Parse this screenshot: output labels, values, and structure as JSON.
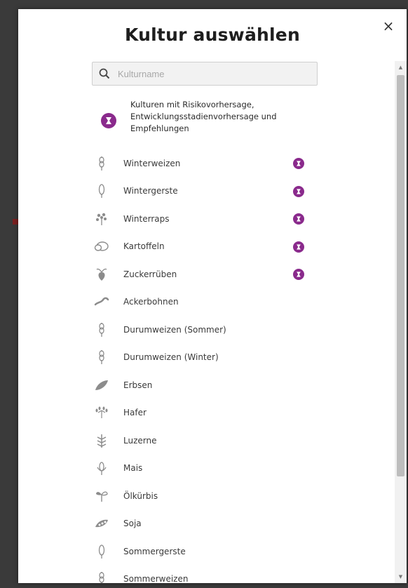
{
  "dialog": {
    "title": "Kultur auswählen",
    "close_label": "×"
  },
  "search": {
    "placeholder": "Kulturname",
    "value": ""
  },
  "legend": {
    "text": "Kulturen mit Risikovorhersage, Entwicklungsstadienvorhersage und Empfehlungen",
    "badge_color": "#8a2a8c"
  },
  "crops": [
    {
      "label": "Winterweizen",
      "icon": "wheat-icon",
      "has_badge": true
    },
    {
      "label": "Wintergerste",
      "icon": "barley-icon",
      "has_badge": true
    },
    {
      "label": "Winterraps",
      "icon": "rapeseed-icon",
      "has_badge": true
    },
    {
      "label": "Kartoffeln",
      "icon": "potato-icon",
      "has_badge": true
    },
    {
      "label": "Zuckerrüben",
      "icon": "sugarbeet-icon",
      "has_badge": true
    },
    {
      "label": "Ackerbohnen",
      "icon": "bean-icon",
      "has_badge": false
    },
    {
      "label": "Durumweizen (Sommer)",
      "icon": "wheat-icon",
      "has_badge": false
    },
    {
      "label": "Durumweizen (Winter)",
      "icon": "wheat-icon",
      "has_badge": false
    },
    {
      "label": "Erbsen",
      "icon": "pea-icon",
      "has_badge": false
    },
    {
      "label": "Hafer",
      "icon": "oat-icon",
      "has_badge": false
    },
    {
      "label": "Luzerne",
      "icon": "alfalfa-icon",
      "has_badge": false
    },
    {
      "label": "Mais",
      "icon": "corn-icon",
      "has_badge": false
    },
    {
      "label": "Ölkürbis",
      "icon": "pumpkin-icon",
      "has_badge": false
    },
    {
      "label": "Soja",
      "icon": "soy-icon",
      "has_badge": false
    },
    {
      "label": "Sommergerste",
      "icon": "barley-icon",
      "has_badge": false
    },
    {
      "label": "Sommerweizen",
      "icon": "wheat-icon",
      "has_badge": false
    }
  ],
  "colors": {
    "accent": "#8a2a8c",
    "icon": "#8c8c8c",
    "text": "#3a3a3a"
  }
}
